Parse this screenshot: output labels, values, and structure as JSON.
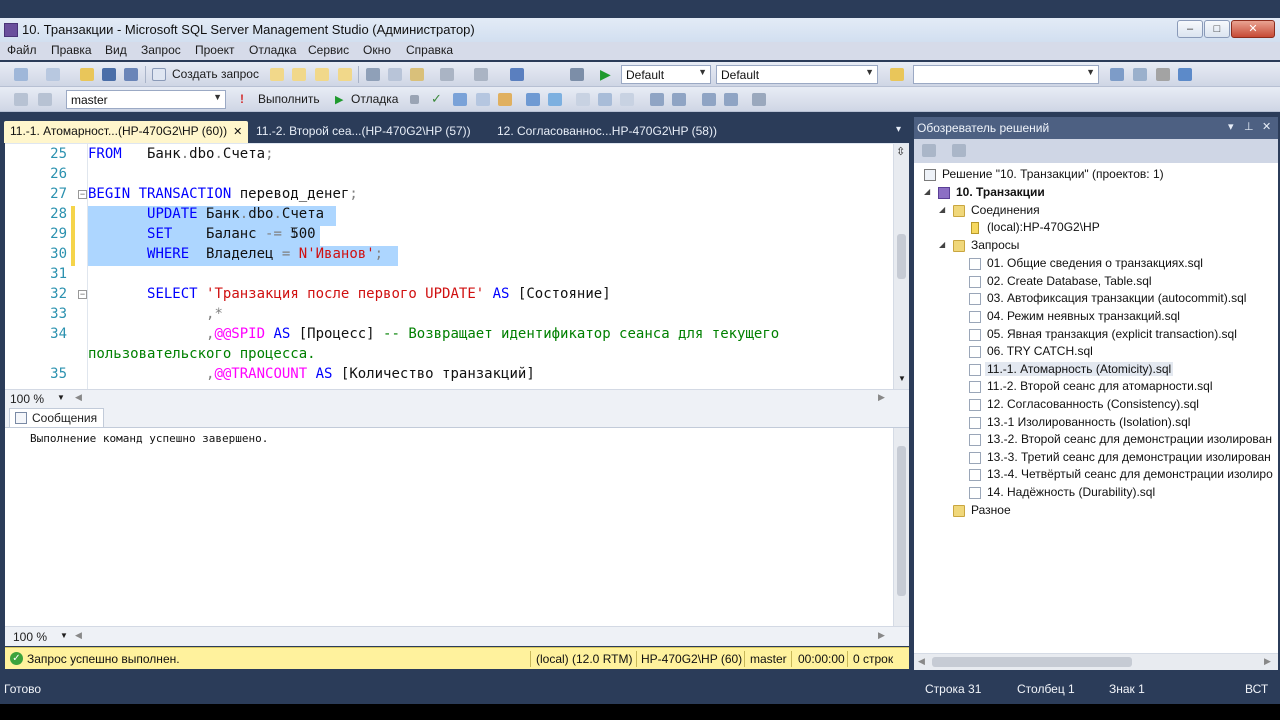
{
  "window": {
    "title": "10. Транзакции - Microsoft SQL Server Management Studio (Администратор)",
    "minimize": "–",
    "maximize": "□",
    "close": "✕"
  },
  "menu": [
    "Файл",
    "Правка",
    "Вид",
    "Запрос",
    "Проект",
    "Отладка",
    "Сервис",
    "Окно",
    "Справка"
  ],
  "toolbar1": {
    "new_query": "Создать запрос",
    "combo1": "Default",
    "combo2": "Default",
    "combo3": ""
  },
  "toolbar2": {
    "database": "master",
    "execute": "Выполнить",
    "debug": "Отладка"
  },
  "doc_tabs": [
    {
      "label": "11.-1. Атомарност...(HP-470G2\\HP (60))",
      "close": "✕"
    },
    {
      "label": "11.-2. Второй сеа...(HP-470G2\\HP (57))"
    },
    {
      "label": "12. Согласованнос...HP-470G2\\HP (58))"
    }
  ],
  "editor": {
    "line_numbers": [
      "25",
      "26",
      "27",
      "28",
      "29",
      "30",
      "31",
      "32",
      "33",
      "34",
      "",
      "35"
    ],
    "zoom": "100 %"
  },
  "results": {
    "tab": "Сообщения",
    "message": "Выполнение команд успешно завершено.",
    "zoom": "100 %"
  },
  "query_status": {
    "message": "Запрос успешно выполнен.",
    "server": "(local) (12.0 RTM)",
    "login": "HP-470G2\\HP (60)",
    "database": "master",
    "time": "00:00:00",
    "rows": "0 строк"
  },
  "solution_explorer": {
    "title": "Обозреватель решений",
    "solution": "Решение \"10. Транзакции\"  (проектов: 1)",
    "project": "10. Транзакции",
    "connections_folder": "Соединения",
    "connection": "(local):HP-470G2\\HP",
    "queries_folder": "Запросы",
    "queries": [
      "01. Общие сведения о транзакциях.sql",
      "02. Create Database, Table.sql",
      "03. Автофиксация транзакции (autocommit).sql",
      "04. Режим неявных транзакций.sql",
      "05. Явная транзакция (explicit transaction).sql",
      "06. TRY CATCH.sql",
      "11.-1. Атомарность (Atomicity).sql",
      "11.-2. Второй сеанс для атомарности.sql",
      "12. Согласованность (Consistency).sql",
      "13.-1 Изолированность (Isolation).sql",
      "13.-2. Второй сеанс для демонстрации изолирован",
      "13.-3. Третий сеанс для демонстрации изолирован",
      "13.-4. Четвёртый сеанс для демонстрации изолиро",
      "14. Надёжность (Durability).sql"
    ],
    "misc_folder": "Разное"
  },
  "statusbar": {
    "ready": "Готово",
    "line": "Строка 31",
    "column": "Столбец 1",
    "char": "Знак 1",
    "mode": "ВСТ"
  },
  "colors": {
    "frame": "#2b3c59",
    "keyword": "#0000ff",
    "string": "#d01010",
    "comment": "#008000",
    "system_function": "#ff00ff",
    "selection": "#add6ff",
    "status_ok_bg": "#fff29d"
  }
}
